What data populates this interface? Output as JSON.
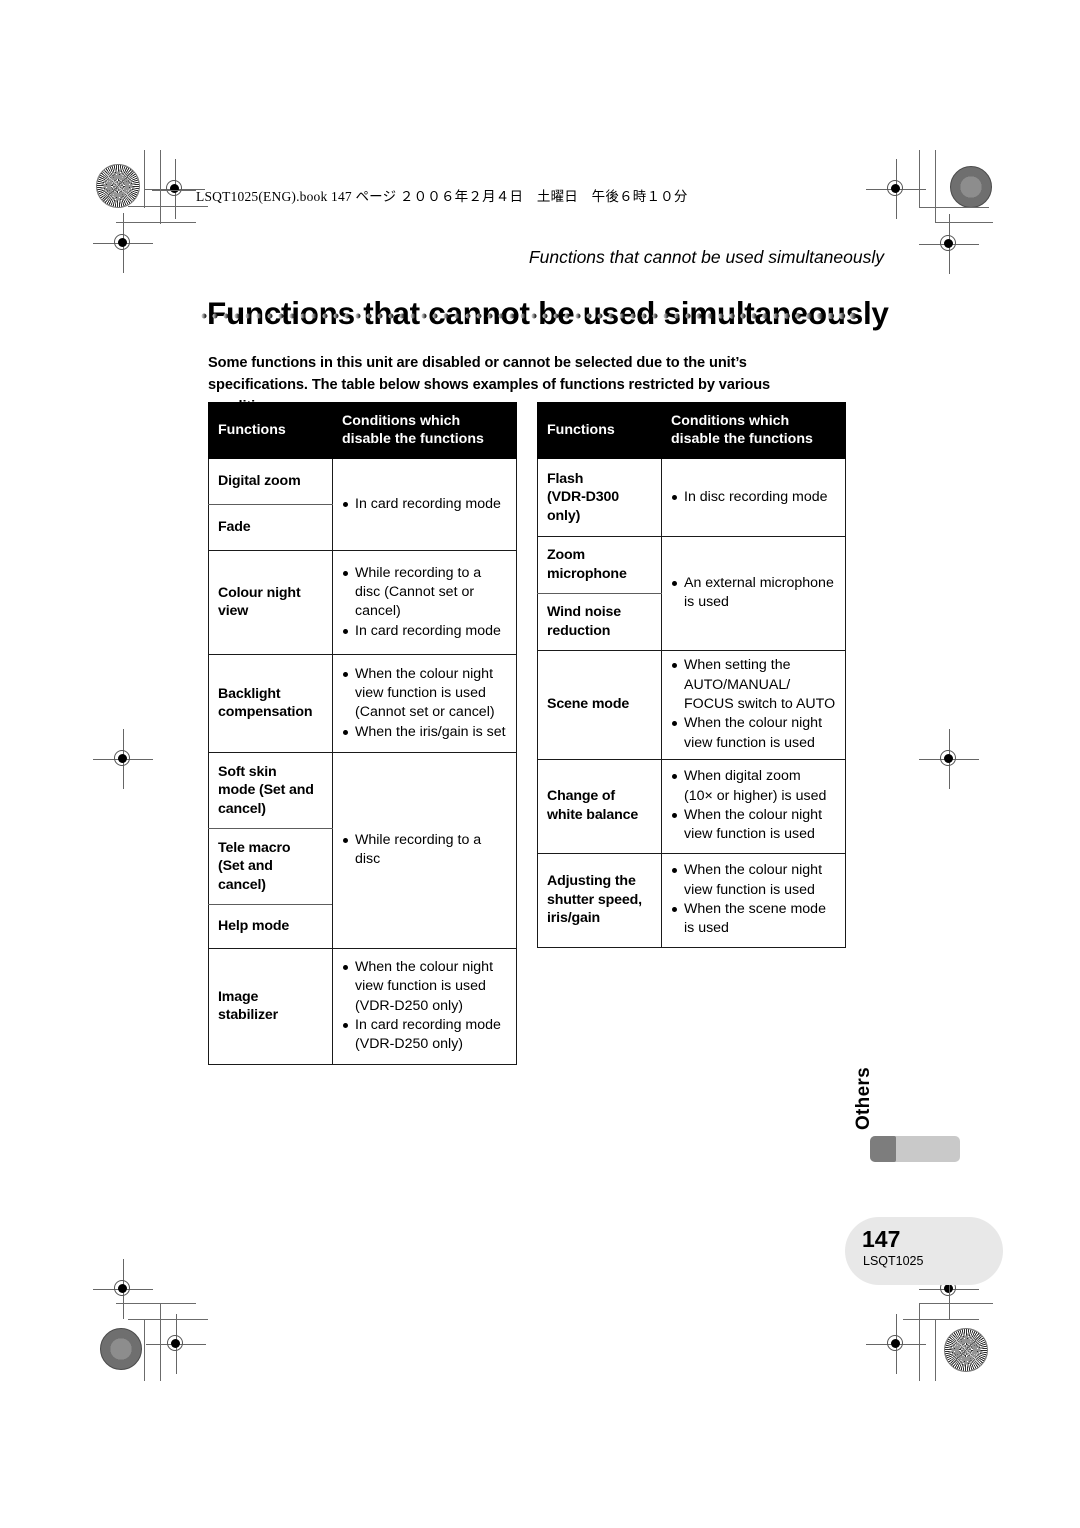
{
  "header": {
    "file_line": "LSQT1025(ENG).book  147 ページ  ２００６年２月４日　土曜日　午後６時１０分"
  },
  "running_head": "Functions that cannot be used simultaneously",
  "page_title": "Functions that cannot be used simultaneously",
  "intro": "Some functions in this unit are disabled or cannot be selected due to the unit’s specifications. The table below shows examples of functions restricted by various conditions.",
  "table_headers": {
    "functions": "Functions",
    "conditions_line1": "Conditions which",
    "conditions_line2": "disable the functions"
  },
  "left_table": [
    {
      "functions": [
        "Digital zoom",
        "Fade"
      ],
      "conditions": [
        [
          "In card recording mode"
        ]
      ]
    },
    {
      "functions": [
        "Colour night view"
      ],
      "conditions": [
        [
          "While recording to a",
          "disc (Cannot set or",
          "cancel)"
        ],
        [
          "In card recording mode"
        ]
      ]
    },
    {
      "functions": [
        "Backlight compensation"
      ],
      "conditions": [
        [
          "When the colour night",
          "view function is used",
          "(Cannot set or cancel)"
        ],
        [
          "When the iris/gain is set"
        ]
      ]
    },
    {
      "functions": [
        "Soft skin mode (Set and cancel)",
        "Tele macro (Set and cancel)",
        "Help mode"
      ],
      "conditions": [
        [
          "While recording to a",
          "disc"
        ]
      ]
    },
    {
      "functions": [
        "Image stabilizer"
      ],
      "conditions": [
        [
          "When the colour night",
          "view function is used",
          "(VDR-D250 only)"
        ],
        [
          "In card recording mode",
          "(VDR-D250 only)"
        ]
      ]
    }
  ],
  "right_table": [
    {
      "functions": [
        "Flash (VDR-D300 only)"
      ],
      "conditions": [
        [
          "In disc recording mode"
        ]
      ]
    },
    {
      "functions": [
        "Zoom microphone",
        "Wind noise reduction"
      ],
      "conditions": [
        [
          "An external microphone",
          "is used"
        ]
      ]
    },
    {
      "functions": [
        "Scene mode"
      ],
      "conditions": [
        [
          "When setting the",
          "AUTO/MANUAL/",
          "FOCUS switch to AUTO"
        ],
        [
          "When the colour night",
          "view function is used"
        ]
      ]
    },
    {
      "functions": [
        "Change of white balance"
      ],
      "conditions": [
        [
          "When digital zoom",
          "(10× or higher) is used"
        ],
        [
          "When the colour night",
          "view function is used"
        ]
      ]
    },
    {
      "functions": [
        "Adjusting the shutter speed, iris/gain"
      ],
      "conditions": [
        [
          "When the colour night",
          "view function is used"
        ],
        [
          "When the scene mode",
          "is used"
        ]
      ]
    }
  ],
  "footer": {
    "side_tab": "Others",
    "page_number": "147",
    "doc_code": "LSQT1025"
  },
  "colors": {
    "header_bg": "#000000",
    "header_text": "#ffffff",
    "tab_active": "#7d7d7d",
    "tab_track": "#c9c9c9",
    "page_box": "#e8e8e8"
  }
}
